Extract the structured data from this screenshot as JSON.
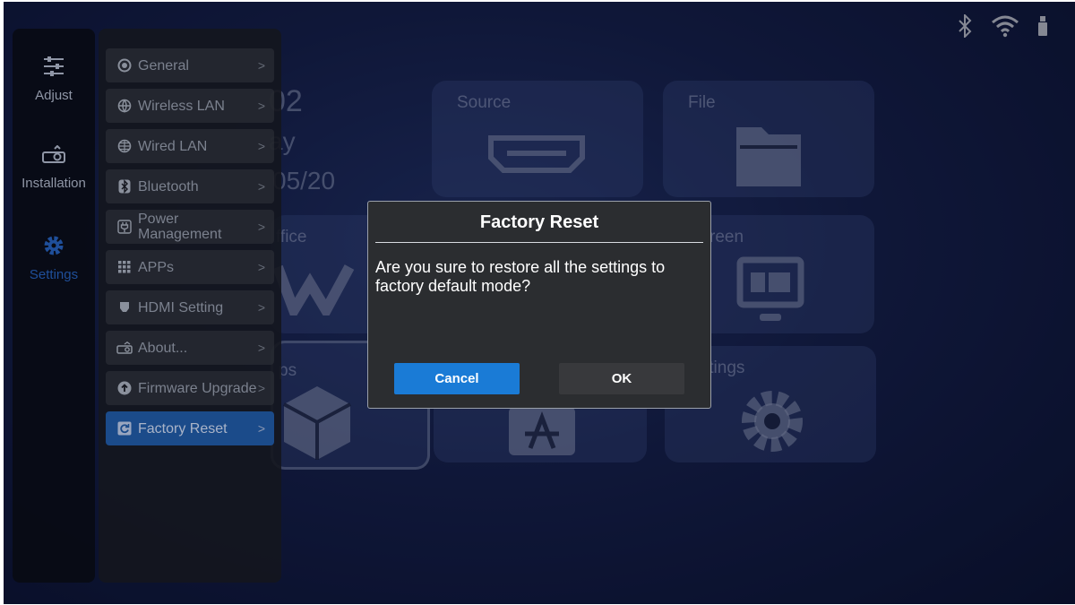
{
  "status_icons": [
    "bluetooth-icon",
    "wifi-icon",
    "usb-icon"
  ],
  "home": {
    "date_lines": [
      "02",
      "ay",
      "05/20"
    ],
    "tiles": {
      "source": "Source",
      "file": "File",
      "office": "ffice",
      "screen": "reen",
      "apps": "ps",
      "settings": "ttings"
    }
  },
  "rail": {
    "items": [
      {
        "label": "Adjust",
        "icon": "sliders-icon"
      },
      {
        "label": "Installation",
        "icon": "projector-icon"
      },
      {
        "label": "Settings",
        "icon": "gear-icon"
      }
    ]
  },
  "submenu": {
    "items": [
      {
        "label": "General",
        "icon": "circle-icon"
      },
      {
        "label": "Wireless LAN",
        "icon": "wireless-globe-icon"
      },
      {
        "label": "Wired LAN",
        "icon": "globe-icon"
      },
      {
        "label": "Bluetooth",
        "icon": "bluetooth-icon"
      },
      {
        "label": "Power Management",
        "icon": "power-plug-icon"
      },
      {
        "label": "APPs",
        "icon": "grid-icon"
      },
      {
        "label": "HDMI Setting",
        "icon": "hdmi-icon"
      },
      {
        "label": "About...",
        "icon": "projector-icon"
      },
      {
        "label": "Firmware Upgrade",
        "icon": "upgrade-icon"
      },
      {
        "label": "Factory Reset",
        "icon": "reset-icon"
      }
    ],
    "selected": "Factory Reset",
    "arrow": ">"
  },
  "dialog": {
    "title": "Factory Reset",
    "message": "Are you sure to restore all the settings to factory default mode?",
    "cancel_label": "Cancel",
    "ok_label": "OK"
  },
  "colors": {
    "accent": "#1a7bd6",
    "selected_menu": "#1b4b8a",
    "dialog_bg": "#2b2d30"
  }
}
